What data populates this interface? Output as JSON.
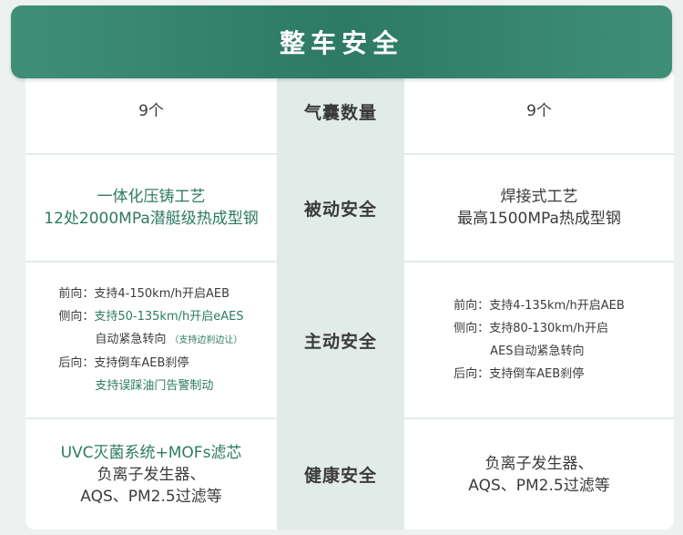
{
  "header": {
    "title": "整车安全"
  },
  "rows": [
    {
      "label": "气囊数量",
      "left": {
        "text": "9个"
      },
      "right": {
        "text": "9个"
      }
    },
    {
      "label": "被动安全",
      "left": {
        "lines": [
          "一体化压铸工艺",
          "12处2000MPa潜艇级热成型钢"
        ]
      },
      "right": {
        "lines": [
          "焊接式工艺",
          "最高1500MPa热成型钢"
        ]
      }
    },
    {
      "label": "主动安全",
      "left": {
        "front": {
          "prefix": "前向：",
          "text": "支持4-150km/h开启AEB"
        },
        "side": {
          "prefix": "侧向：",
          "text": "支持50-135km/h开启eAES"
        },
        "side2": {
          "text": "自动紧急转向",
          "note": "（支持边刹边让）"
        },
        "rear": {
          "prefix": "后向：",
          "text": "支持倒车AEB刹停"
        },
        "rear2": {
          "text": "支持误踩油门告警制动"
        }
      },
      "right": {
        "front": {
          "prefix": "前向：",
          "text": "支持4-135km/h开启AEB"
        },
        "side": {
          "prefix": "侧向：",
          "text": "支持80-130km/h开启"
        },
        "side2": {
          "text": "AES自动紧急转向"
        },
        "rear": {
          "prefix": "后向：",
          "text": "支持倒车AEB刹停"
        }
      }
    },
    {
      "label": "健康安全",
      "left": {
        "lines": [
          "UVC灭菌系统+MOFs滤芯",
          "负离子发生器、",
          "AQS、PM2.5过滤等"
        ]
      },
      "right": {
        "lines": [
          "负离子发生器、",
          "AQS、PM2.5过滤等"
        ]
      }
    }
  ],
  "colors": {
    "accent": "#2d7a64",
    "banner": "#3f8f77",
    "text": "#3b3b3b",
    "middle_column": "#e1ebe8"
  }
}
